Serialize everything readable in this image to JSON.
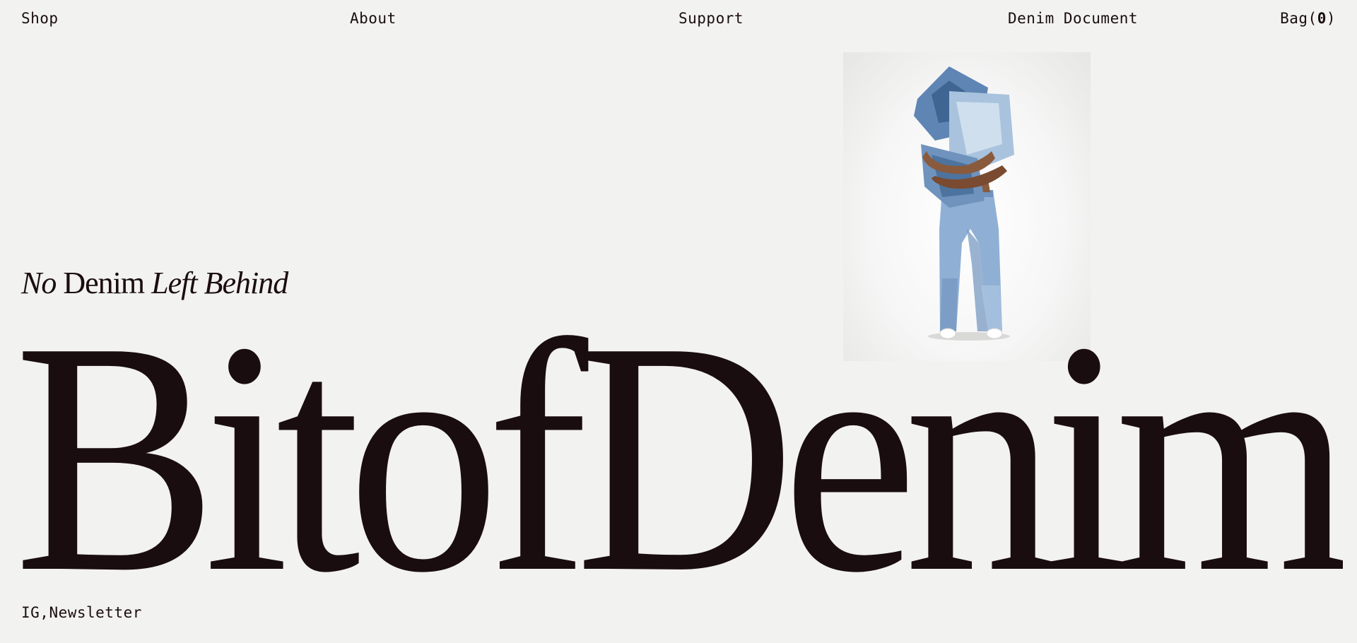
{
  "nav": {
    "shop": "Shop",
    "about": "About",
    "support": "Support",
    "denim_document": "Denim Document",
    "bag_label": "Bag(",
    "bag_count": "0",
    "bag_close": ")"
  },
  "hero": {
    "tagline_part1": "No",
    "tagline_part2": " Denim ",
    "tagline_part3": "Left Behind",
    "wordmark": "BitofDenim",
    "photo_alt": "Person hugging patchwork denim pillows wearing jeans"
  },
  "footer": {
    "ig": "IG",
    "separator": ",",
    "newsletter": "Newsletter"
  },
  "colors": {
    "background": "#f2f2f0",
    "text": "#1a0d0f",
    "denim_light": "#a9c3de",
    "denim_mid": "#6f93bd",
    "denim_dark": "#3f6593"
  }
}
